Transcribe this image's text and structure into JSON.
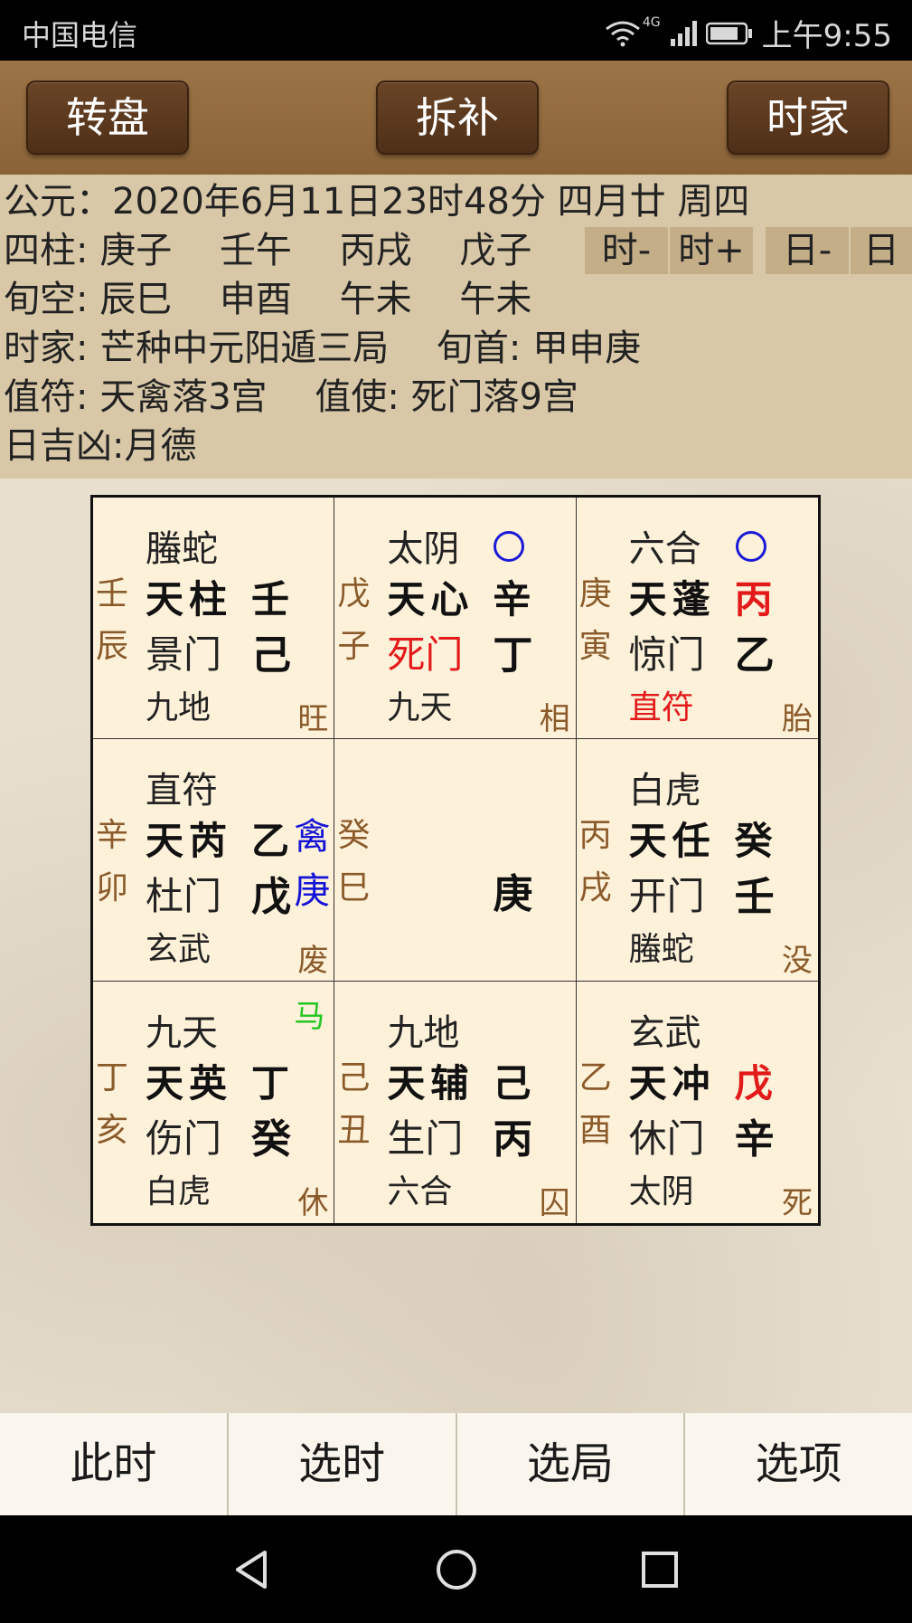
{
  "status_bar": {
    "carrier": "中国电信",
    "network": "4G",
    "time": "上午9:55",
    "icons": [
      "wifi-icon",
      "signal-icon",
      "battery-icon"
    ]
  },
  "toolbar": {
    "left_label": "转盘",
    "center_label": "拆补",
    "right_label": "时家"
  },
  "info": {
    "gongyuan": "公元：2020年6月11日23时48分 四月廿 周四",
    "sizhu": "四柱: 庚子　 壬午　 丙戌　 戊子",
    "xunkong": "旬空: 辰巳　 申酉　 午未　 午未",
    "shijia": "时家: 芒种中元阳遁三局　 旬首: 甲申庚",
    "zhifu": "值符: 天禽落3宫　 值使: 死门落9宫",
    "rijixiong": "日吉凶:月德",
    "buttons": [
      "时-",
      "时+",
      "日-",
      "日"
    ]
  },
  "palaces": [
    {
      "gz1": "壬",
      "gz2": "辰",
      "god": "螣蛇",
      "star": "天柱",
      "tianstem": "壬",
      "door": "景门",
      "earthstem": "己",
      "deity2": "九地",
      "state": "旺"
    },
    {
      "gz1": "戊",
      "gz2": "子",
      "god": "太阴",
      "star": "天心",
      "tianstem": "辛",
      "door": "死门",
      "earthstem": "丁",
      "deity2": "九天",
      "state": "相",
      "door_color": "#e31a1a",
      "kongwang": true
    },
    {
      "gz1": "庚",
      "gz2": "寅",
      "god": "六合",
      "star": "天蓬",
      "tianstem": "丙",
      "door": "惊门",
      "earthstem": "乙",
      "deity2": "直符",
      "state": "胎",
      "tianstem_color": "#e31a1a",
      "deity2_color": "#e31a1a",
      "kongwang": true
    },
    {
      "gz1": "辛",
      "gz2": "卯",
      "god": "直符",
      "star": "天芮",
      "tianstem": "乙",
      "door": "杜门",
      "earthstem": "戊",
      "deity2": "玄武",
      "state": "废",
      "extra1": "禽",
      "extra2": "庚"
    },
    {
      "gz1": "癸",
      "gz2": "巳",
      "center_stem": "庚"
    },
    {
      "gz1": "丙",
      "gz2": "戌",
      "god": "白虎",
      "star": "天任",
      "tianstem": "癸",
      "door": "开门",
      "earthstem": "壬",
      "deity2": "螣蛇",
      "state": "没"
    },
    {
      "gz1": "丁",
      "gz2": "亥",
      "god": "九天",
      "star": "天英",
      "tianstem": "丁",
      "door": "伤门",
      "earthstem": "癸",
      "deity2": "白虎",
      "state": "休",
      "horse": "马"
    },
    {
      "gz1": "己",
      "gz2": "丑",
      "god": "九地",
      "star": "天辅",
      "tianstem": "己",
      "door": "生门",
      "earthstem": "丙",
      "deity2": "六合",
      "state": "囚"
    },
    {
      "gz1": "乙",
      "gz2": "酉",
      "god": "玄武",
      "star": "天冲",
      "tianstem": "戊",
      "door": "休门",
      "earthstem": "辛",
      "deity2": "太阴",
      "state": "死",
      "tianstem_color": "#e31a1a"
    }
  ],
  "bottom_bar": {
    "items": [
      "此时",
      "选时",
      "选局",
      "选项"
    ]
  },
  "nav": {
    "icons": [
      "back-icon",
      "home-icon",
      "recents-icon"
    ]
  },
  "colors": {
    "toolbar_bg": "#8a6338",
    "info_bg": "#d9c8a7",
    "cell_bg": "#fdf1da",
    "accent_red": "#e31a1a",
    "blue": "#1414d6",
    "green": "#22c622"
  }
}
